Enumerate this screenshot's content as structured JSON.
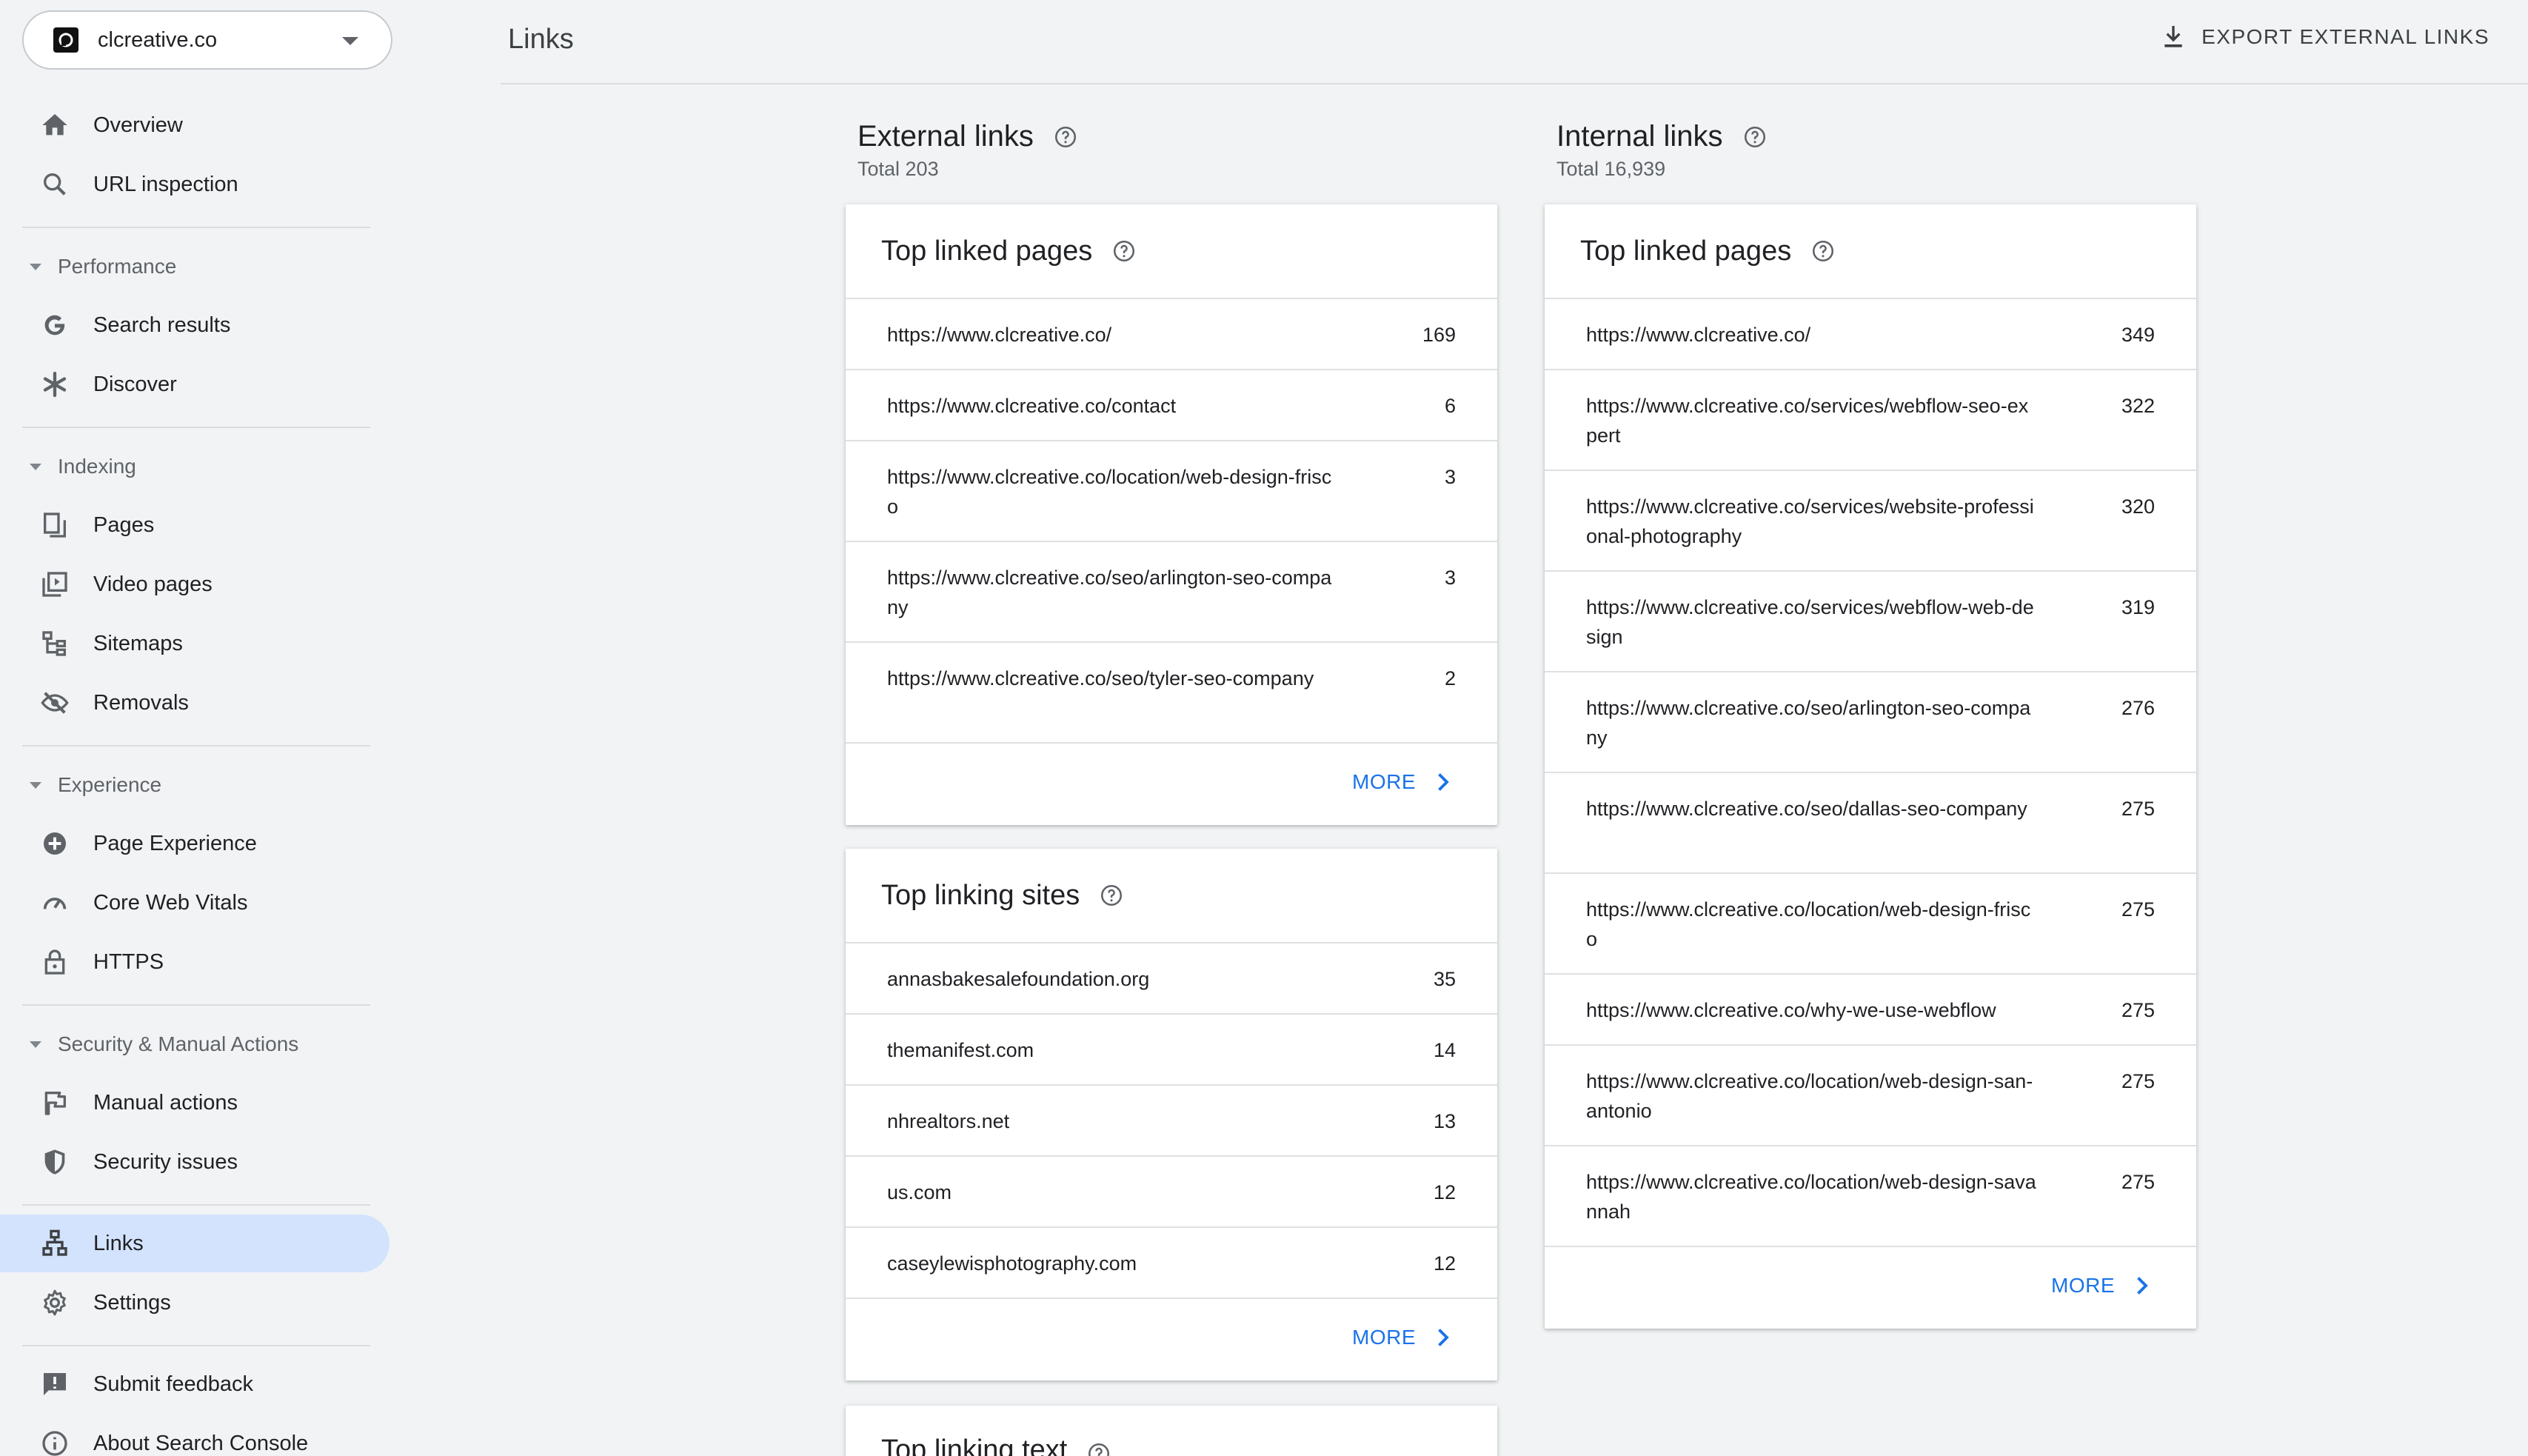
{
  "property": {
    "name": "clcreative.co"
  },
  "nav": {
    "overview": "Overview",
    "url_inspection": "URL inspection",
    "performance_section": "Performance",
    "search_results": "Search results",
    "discover": "Discover",
    "indexing_section": "Indexing",
    "pages": "Pages",
    "video_pages": "Video pages",
    "sitemaps": "Sitemaps",
    "removals": "Removals",
    "experience_section": "Experience",
    "page_experience": "Page Experience",
    "core_web_vitals": "Core Web Vitals",
    "https": "HTTPS",
    "security_section": "Security & Manual Actions",
    "manual_actions": "Manual actions",
    "security_issues": "Security issues",
    "links": "Links",
    "settings": "Settings",
    "submit_feedback": "Submit feedback",
    "about": "About Search Console"
  },
  "header": {
    "title": "Links",
    "export_label": "EXPORT EXTERNAL LINKS"
  },
  "external": {
    "title": "External links",
    "total": "Total 203",
    "top_linked": {
      "title": "Top linked pages",
      "rows": [
        {
          "url": "https://www.clcreative.co/",
          "count": "169"
        },
        {
          "url": "https://www.clcreative.co/contact",
          "count": "6"
        },
        {
          "url": "https://www.clcreative.co/location/web-design-frisco",
          "count": "3"
        },
        {
          "url": "https://www.clcreative.co/seo/arlington-seo-company",
          "count": "3"
        },
        {
          "url": "https://www.clcreative.co/seo/tyler-seo-company",
          "count": "2"
        }
      ],
      "more": "MORE"
    },
    "top_sites": {
      "title": "Top linking sites",
      "rows": [
        {
          "url": "annasbakesalefoundation.org",
          "count": "35"
        },
        {
          "url": "themanifest.com",
          "count": "14"
        },
        {
          "url": "nhrealtors.net",
          "count": "13"
        },
        {
          "url": "us.com",
          "count": "12"
        },
        {
          "url": "caseylewisphotography.com",
          "count": "12"
        }
      ],
      "more": "MORE"
    },
    "top_text": {
      "title": "Top linking text"
    }
  },
  "internal": {
    "title": "Internal links",
    "total": "Total 16,939",
    "top_linked": {
      "title": "Top linked pages",
      "rows": [
        {
          "url": "https://www.clcreative.co/",
          "count": "349"
        },
        {
          "url": "https://www.clcreative.co/services/webflow-seo-expert",
          "count": "322"
        },
        {
          "url": "https://www.clcreative.co/services/website-professional-photography",
          "count": "320"
        },
        {
          "url": "https://www.clcreative.co/services/webflow-web-design",
          "count": "319"
        },
        {
          "url": "https://www.clcreative.co/seo/arlington-seo-company",
          "count": "276"
        },
        {
          "url": "https://www.clcreative.co/seo/dallas-seo-company",
          "count": "275"
        },
        {
          "url": "https://www.clcreative.co/location/web-design-frisco",
          "count": "275"
        },
        {
          "url": "https://www.clcreative.co/why-we-use-webflow",
          "count": "275"
        },
        {
          "url": "https://www.clcreative.co/location/web-design-san-antonio",
          "count": "275"
        },
        {
          "url": "https://www.clcreative.co/location/web-design-savannah",
          "count": "275"
        }
      ],
      "more": "MORE"
    }
  }
}
